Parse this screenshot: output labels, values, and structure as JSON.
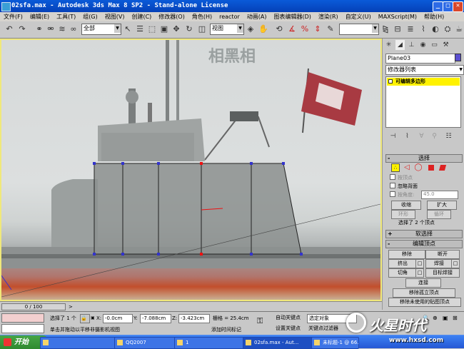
{
  "window": {
    "title": "02sfa.max - Autodesk 3ds Max 8 SP2 - Stand-alone License",
    "controls": [
      "_",
      "□",
      "✕"
    ]
  },
  "menu": [
    "文件(F)",
    "编辑(E)",
    "工具(T)",
    "组(G)",
    "视图(V)",
    "创建(C)",
    "修改器(O)",
    "角色(H)",
    "reactor",
    "动画(A)",
    "图表编辑器(D)",
    "渲染(R)",
    "自定义(U)",
    "MAXScript(M)",
    "帮助(H)"
  ],
  "toolbar": {
    "selection_filter": "全部",
    "ref_coord": "视图"
  },
  "viewport": {
    "banner_text": "相黑相"
  },
  "command_panel": {
    "object_name": "Plane03",
    "modifier_list": "修改器列表",
    "stack_item": "可编辑多边形",
    "selection": {
      "title": "选择",
      "by_vertex": "按顶点",
      "ignore_backfacing": "忽略背面",
      "by_angle": "按角度:",
      "angle_value": "45.0",
      "shrink": "收缩",
      "grow": "扩大",
      "ring": "环形",
      "loop": "循环",
      "status": "选择了 2 个顶点"
    },
    "soft_selection": {
      "title": "软选择"
    },
    "edit_vertices": {
      "title": "编辑顶点",
      "remove": "移除",
      "break": "断开",
      "extrude": "挤出",
      "weld": "焊接",
      "chamfer": "切角",
      "target_weld": "目标焊接",
      "connect": "连接",
      "remove_isolated": "移除孤立顶点",
      "remove_unused_map": "移除未使用的贴图顶点"
    }
  },
  "timeline": {
    "frame": "0 / 100"
  },
  "status": {
    "selection_count": "选择了 1 个",
    "x_label": "X:",
    "x_value": "-0.0cm",
    "y_label": "Y:",
    "y_value": "-7.088cm",
    "z_label": "Z:",
    "z_value": "-3.423cm",
    "grid": "栅格 = 25.4cm",
    "auto_key": "自动关键点",
    "selected_object": "选定对象",
    "set_key": "设置关键点",
    "key_filters": "关键点过滤器",
    "prompt": "单击并拖动以平移非摄影机视图",
    "add_time_tag": "添加时间标记"
  },
  "taskbar": {
    "start": "开始",
    "tasks": [
      "",
      "QQ2007",
      "1",
      "02sfa.max - Aut...",
      "未标题-1 @ 66.7..."
    ]
  },
  "watermark": {
    "brand": "火星时代",
    "url": "www.hxsd.com"
  },
  "colors": {
    "titlebar": "#0a5bd8",
    "viewport_border": "#f0e87a",
    "selected_stack": "#fff200",
    "vertex_red": "#e11",
    "taskbar": "#2557d4"
  }
}
